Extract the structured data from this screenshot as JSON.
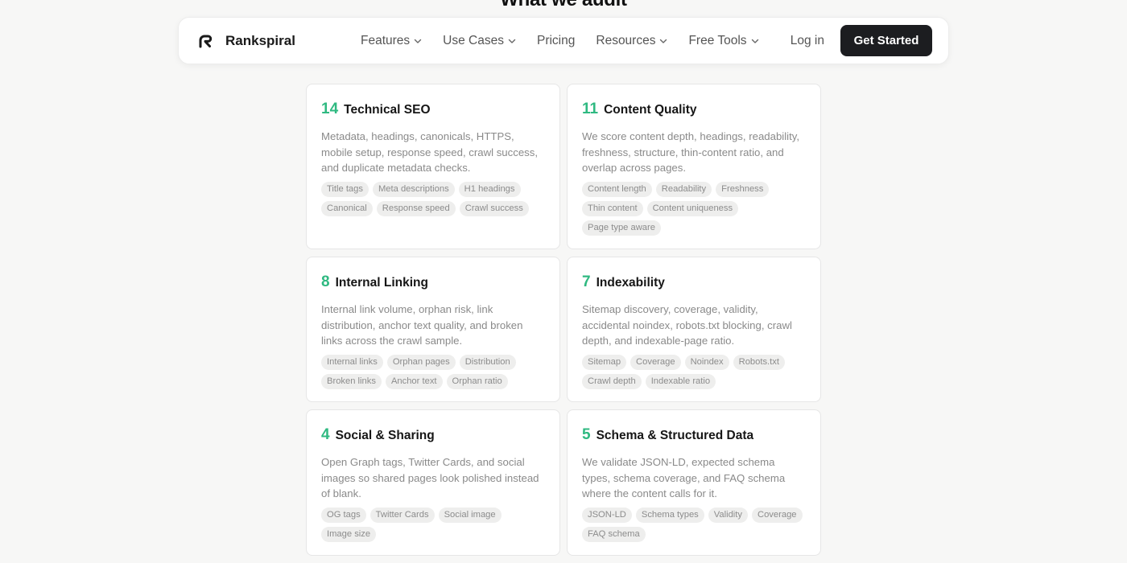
{
  "section": {
    "heading": "What we audit"
  },
  "nav": {
    "brand": "Rankspiral",
    "links": [
      {
        "label": "Features",
        "dropdown": true
      },
      {
        "label": "Use Cases",
        "dropdown": true
      },
      {
        "label": "Pricing",
        "dropdown": false
      },
      {
        "label": "Resources",
        "dropdown": true
      },
      {
        "label": "Free Tools",
        "dropdown": true
      }
    ],
    "login": "Log in",
    "cta": "Get Started"
  },
  "colors": {
    "accent": "#2fb981",
    "cta_bg": "#1c1d20",
    "tag_bg": "#eeeeed"
  },
  "cards": [
    {
      "count": "14",
      "title": "Technical SEO",
      "description": "Metadata, headings, canonicals, HTTPS, mobile setup, response speed, crawl success, and duplicate metadata checks.",
      "tags": [
        "Title tags",
        "Meta descriptions",
        "H1 headings",
        "Canonical",
        "Response speed",
        "Crawl success"
      ]
    },
    {
      "count": "11",
      "title": "Content Quality",
      "description": "We score content depth, headings, readability, freshness, structure, thin-content ratio, and overlap across pages.",
      "tags": [
        "Content length",
        "Readability",
        "Freshness",
        "Thin content",
        "Content uniqueness",
        "Page type aware"
      ]
    },
    {
      "count": "8",
      "title": "Internal Linking",
      "description": "Internal link volume, orphan risk, link distribution, anchor text quality, and broken links across the crawl sample.",
      "tags": [
        "Internal links",
        "Orphan pages",
        "Distribution",
        "Broken links",
        "Anchor text",
        "Orphan ratio"
      ]
    },
    {
      "count": "7",
      "title": "Indexability",
      "description": "Sitemap discovery, coverage, validity, accidental noindex, robots.txt blocking, crawl depth, and indexable-page ratio.",
      "tags": [
        "Sitemap",
        "Coverage",
        "Noindex",
        "Robots.txt",
        "Crawl depth",
        "Indexable ratio"
      ]
    },
    {
      "count": "4",
      "title": "Social & Sharing",
      "description": "Open Graph tags, Twitter Cards, and social images so shared pages look polished instead of blank.",
      "tags": [
        "OG tags",
        "Twitter Cards",
        "Social image",
        "Image size"
      ]
    },
    {
      "count": "5",
      "title": "Schema & Structured Data",
      "description": "We validate JSON-LD, expected schema types, schema coverage, and FAQ schema where the content calls for it.",
      "tags": [
        "JSON-LD",
        "Schema types",
        "Validity",
        "Coverage",
        "FAQ schema"
      ]
    }
  ]
}
